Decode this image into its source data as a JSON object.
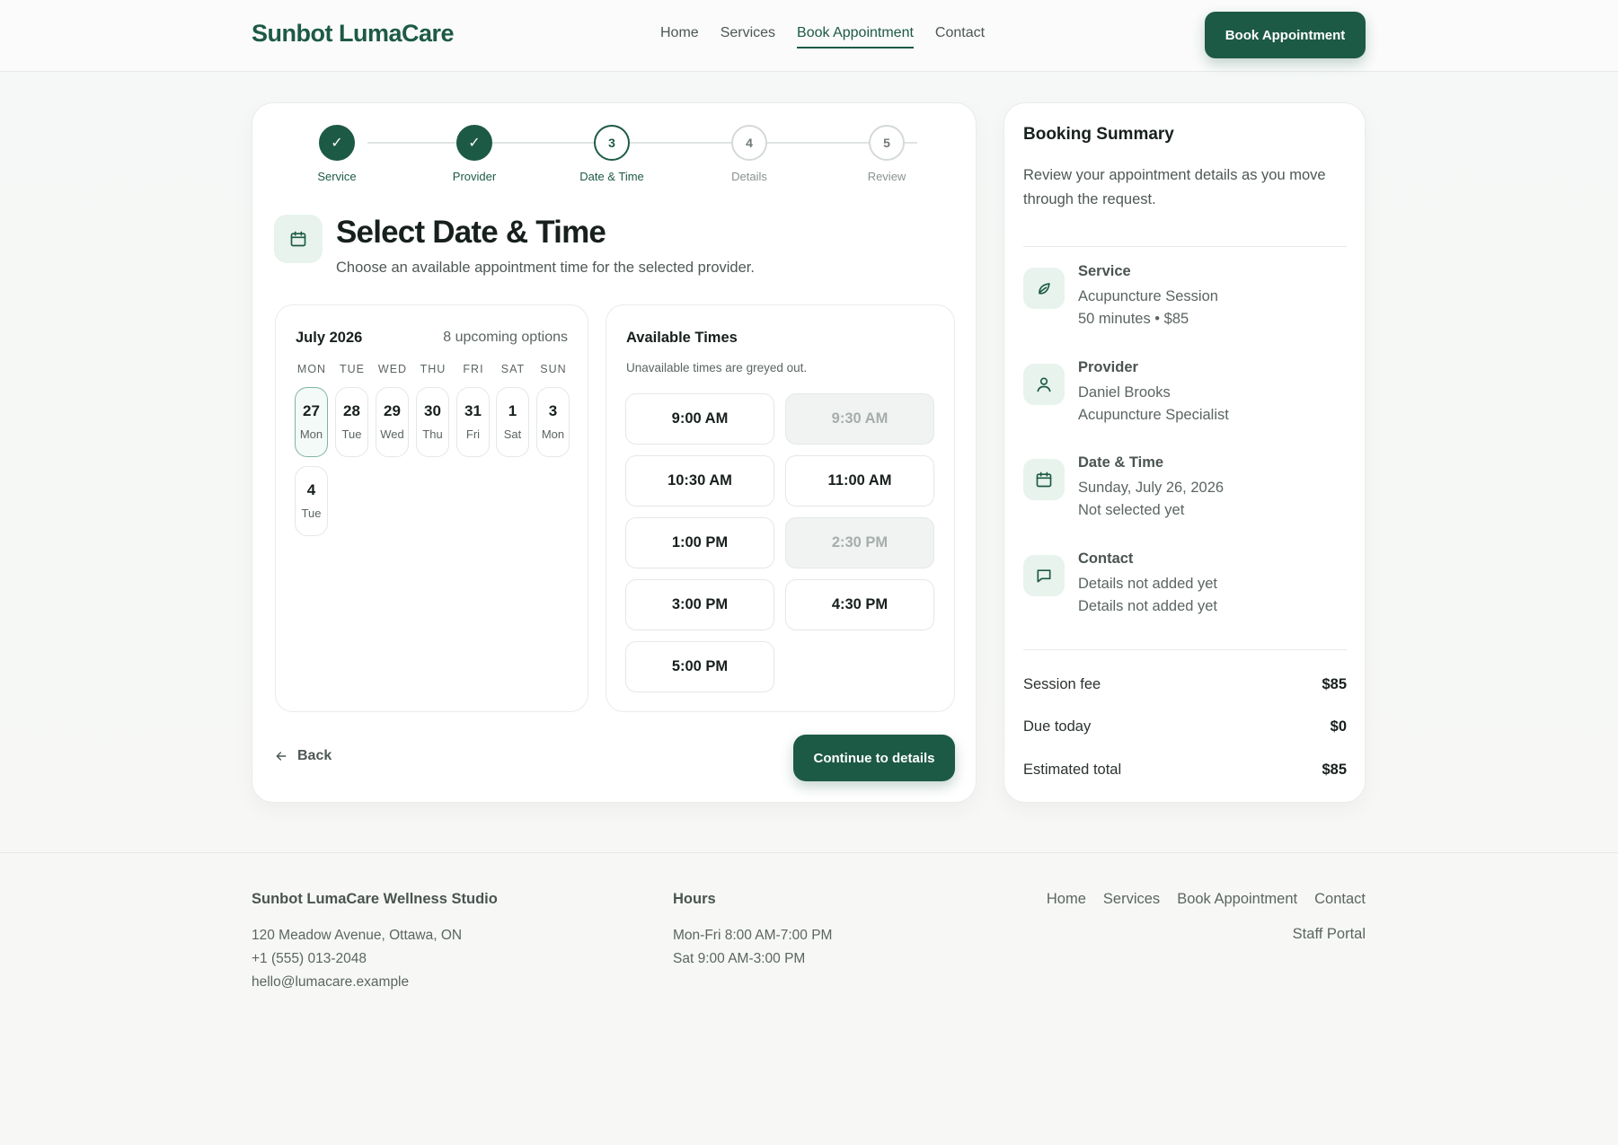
{
  "header": {
    "logo": "Sunbot LumaCare",
    "nav": [
      "Home",
      "Services",
      "Book Appointment",
      "Contact"
    ],
    "active_nav": "Book Appointment",
    "cta": "Book Appointment"
  },
  "stepper": [
    {
      "num": "1",
      "label": "Service",
      "state": "done"
    },
    {
      "num": "2",
      "label": "Provider",
      "state": "done"
    },
    {
      "num": "3",
      "label": "Date & Time",
      "state": "current"
    },
    {
      "num": "4",
      "label": "Details",
      "state": "upcoming"
    },
    {
      "num": "5",
      "label": "Review",
      "state": "upcoming"
    }
  ],
  "main": {
    "title": "Select Date & Time",
    "subtitle": "Choose an available appointment time for the selected provider.",
    "back_label": "Back",
    "continue_label": "Continue to details"
  },
  "calendar": {
    "month": "July 2026",
    "count": "8 upcoming options",
    "weekdays": [
      "MON",
      "TUE",
      "WED",
      "THU",
      "FRI",
      "SAT",
      "SUN"
    ],
    "days": [
      {
        "num": "27",
        "wd": "Mon",
        "selected": true
      },
      {
        "num": "28",
        "wd": "Tue"
      },
      {
        "num": "29",
        "wd": "Wed"
      },
      {
        "num": "30",
        "wd": "Thu"
      },
      {
        "num": "31",
        "wd": "Fri"
      },
      {
        "num": "1",
        "wd": "Sat"
      },
      {
        "num": "3",
        "wd": "Mon"
      },
      {
        "num": "4",
        "wd": "Tue"
      }
    ]
  },
  "times": {
    "title": "Available Times",
    "note": "Unavailable times are greyed out.",
    "slots": [
      {
        "label": "9:00 AM",
        "available": true
      },
      {
        "label": "9:30 AM",
        "available": false
      },
      {
        "label": "10:30 AM",
        "available": true
      },
      {
        "label": "11:00 AM",
        "available": true
      },
      {
        "label": "1:00 PM",
        "available": true
      },
      {
        "label": "2:30 PM",
        "available": false
      },
      {
        "label": "3:00 PM",
        "available": true
      },
      {
        "label": "4:30 PM",
        "available": true
      },
      {
        "label": "5:00 PM",
        "available": true
      }
    ]
  },
  "summary": {
    "title": "Booking Summary",
    "desc": "Review your appointment details as you move through the request.",
    "items": [
      {
        "icon": "leaf-icon",
        "label": "Service",
        "lines": [
          "Acupuncture Session",
          "50 minutes • $85"
        ]
      },
      {
        "icon": "user-icon",
        "label": "Provider",
        "lines": [
          "Daniel Brooks",
          "Acupuncture Specialist"
        ]
      },
      {
        "icon": "calendar-icon",
        "label": "Date & Time",
        "lines": [
          "Sunday, July 26, 2026",
          "Not selected yet"
        ]
      },
      {
        "icon": "chat-icon",
        "label": "Contact",
        "lines": [
          "Details not added yet",
          "Details not added yet"
        ]
      }
    ],
    "fees": [
      {
        "k": "Session fee",
        "v": "$85"
      },
      {
        "k": "Due today",
        "v": "$0"
      },
      {
        "k": "Estimated total",
        "v": "$85"
      }
    ]
  },
  "footer": {
    "studio": "Sunbot LumaCare Wellness Studio",
    "address": "120 Meadow Avenue, Ottawa, ON",
    "phone": "+1 (555) 013-2048",
    "email": "hello@lumacare.example",
    "hours_title": "Hours",
    "hours": [
      "Mon-Fri 8:00 AM-7:00 PM",
      "Sat 9:00 AM-3:00 PM"
    ],
    "links": [
      "Home",
      "Services",
      "Book Appointment",
      "Contact"
    ],
    "staff": "Staff Portal"
  },
  "colors": {
    "brand": "#1d5a45",
    "tint": "#e8f3ee"
  }
}
